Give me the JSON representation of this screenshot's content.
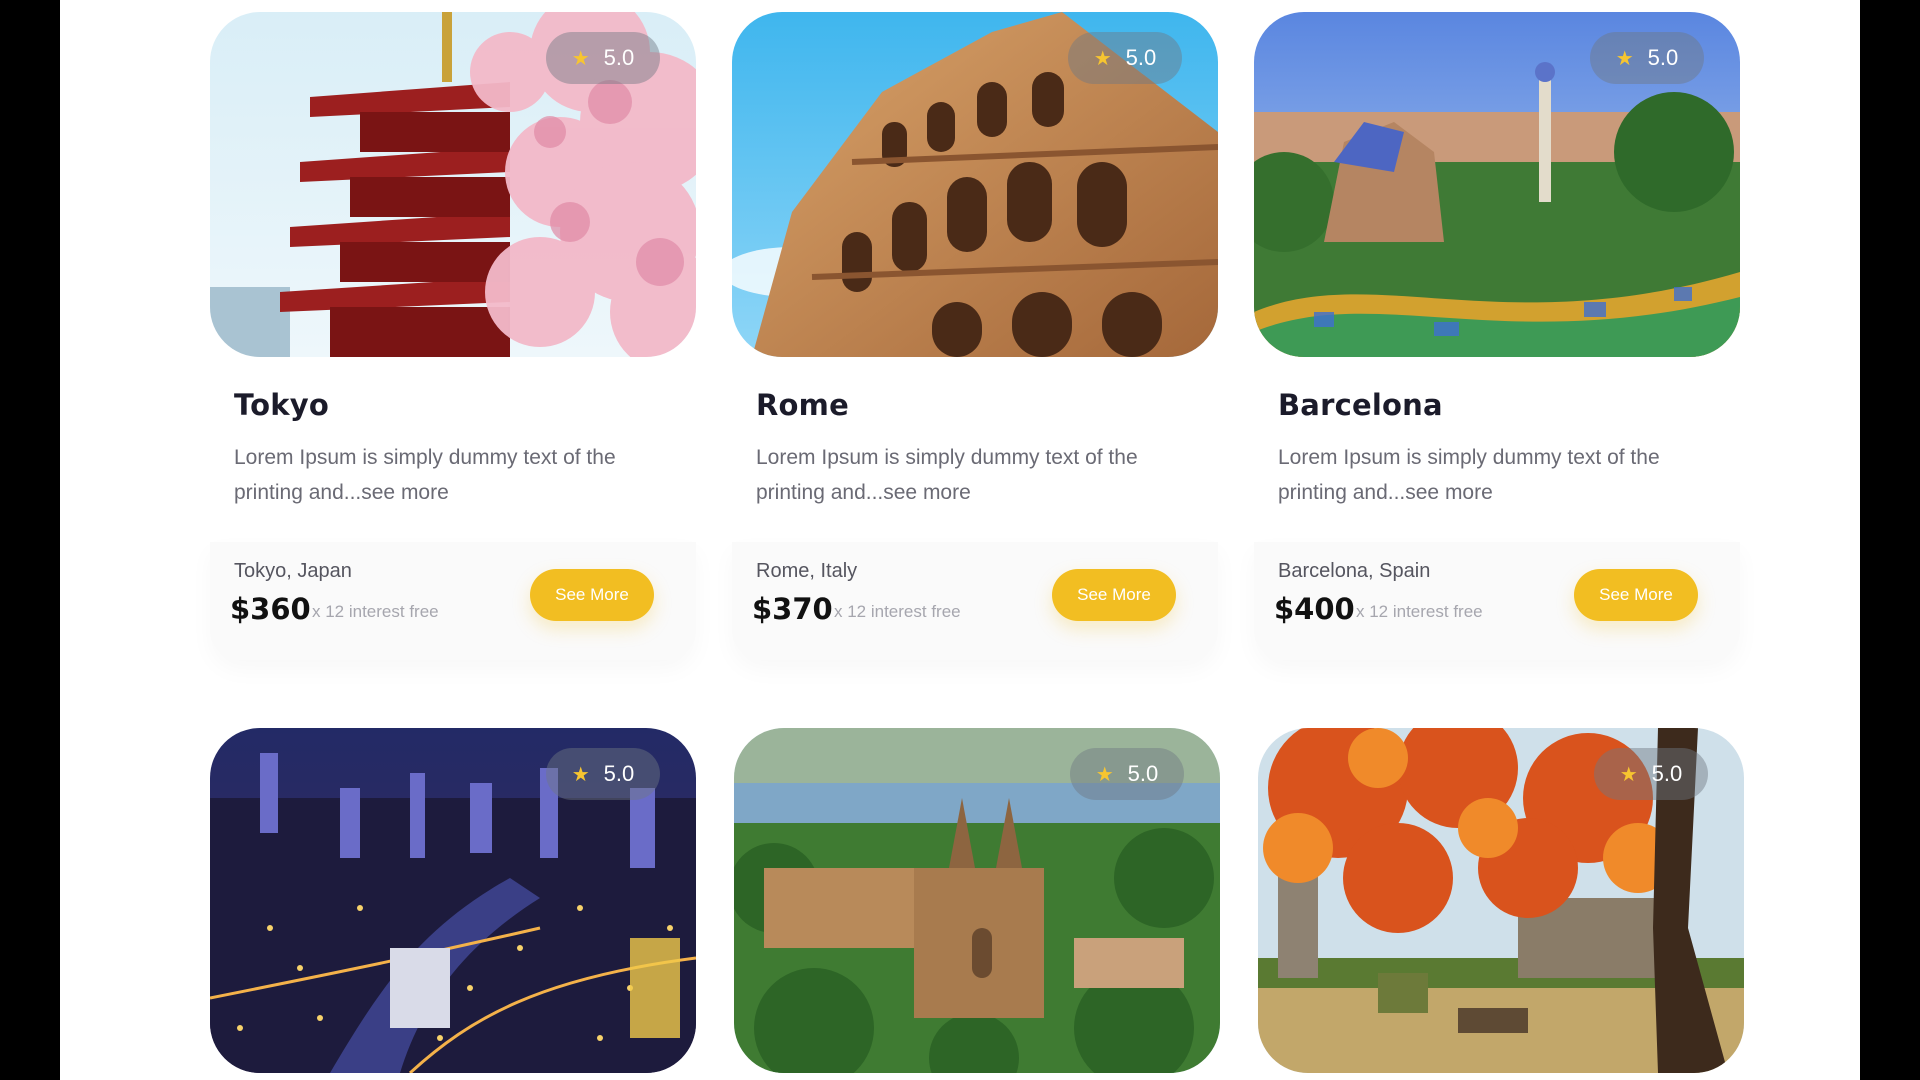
{
  "cards": [
    {
      "title": "Tokyo",
      "rating": "5.0",
      "description": "Lorem Ipsum is simply dummy text of the printing and...see more",
      "location": "Tokyo, Japan",
      "price": "$360",
      "interest": "x 12 interest free",
      "button": "See More"
    },
    {
      "title": "Rome",
      "rating": "5.0",
      "description": "Lorem Ipsum is simply dummy text of the printing and...see more",
      "location": "Rome, Italy",
      "price": "$370",
      "interest": "x 12 interest free",
      "button": "See More"
    },
    {
      "title": "Barcelona",
      "rating": "5.0",
      "description": "Lorem Ipsum is simply dummy text of the printing and...see more",
      "location": "Barcelona, Spain",
      "price": "$400",
      "interest": "x 12 interest free",
      "button": "See More"
    },
    {
      "rating": "5.0"
    },
    {
      "rating": "5.0"
    },
    {
      "rating": "5.0"
    }
  ],
  "colors": {
    "accent": "#f2be22",
    "star": "#f7c530",
    "title": "#1b1b2a",
    "text": "#6a6a74"
  },
  "icons": {
    "rating": "star-icon"
  }
}
